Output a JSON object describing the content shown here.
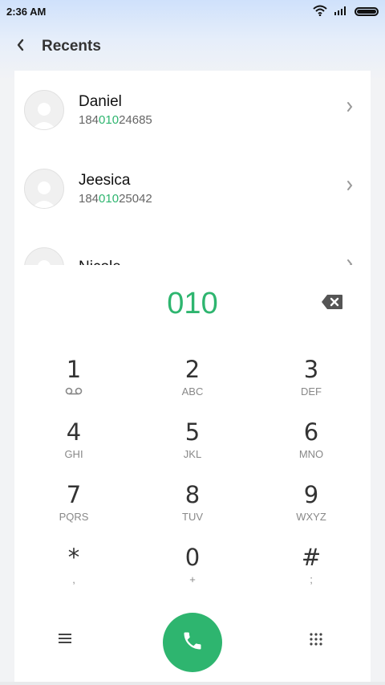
{
  "status_bar": {
    "time": "2:36 AM"
  },
  "header": {
    "title": "Recents"
  },
  "contacts": [
    {
      "name": "Daniel",
      "number_prefix": "184",
      "number_match": "010",
      "number_suffix": "24685"
    },
    {
      "name": "Jeesica",
      "number_prefix": "184",
      "number_match": "010",
      "number_suffix": "25042"
    },
    {
      "name": "Nicole",
      "number_prefix": "",
      "number_match": "",
      "number_suffix": ""
    }
  ],
  "dialpad": {
    "input": "010",
    "keys": [
      {
        "digit": "1",
        "letters": ""
      },
      {
        "digit": "2",
        "letters": "ABC"
      },
      {
        "digit": "3",
        "letters": "DEF"
      },
      {
        "digit": "4",
        "letters": "GHI"
      },
      {
        "digit": "5",
        "letters": "JKL"
      },
      {
        "digit": "6",
        "letters": "MNO"
      },
      {
        "digit": "7",
        "letters": "PQRS"
      },
      {
        "digit": "8",
        "letters": "TUV"
      },
      {
        "digit": "9",
        "letters": "WXYZ"
      },
      {
        "digit": "*",
        "letters": ","
      },
      {
        "digit": "0",
        "letters": "+"
      },
      {
        "digit": "#",
        "letters": ";"
      }
    ]
  },
  "colors": {
    "accent": "#2eb56f"
  },
  "icons": [
    "wifi-icon",
    "signal-icon",
    "battery-icon",
    "back-chevron-icon",
    "chevron-right-icon",
    "backspace-icon",
    "voicemail-icon",
    "menu-icon",
    "call-icon",
    "dialpad-grid-icon"
  ]
}
